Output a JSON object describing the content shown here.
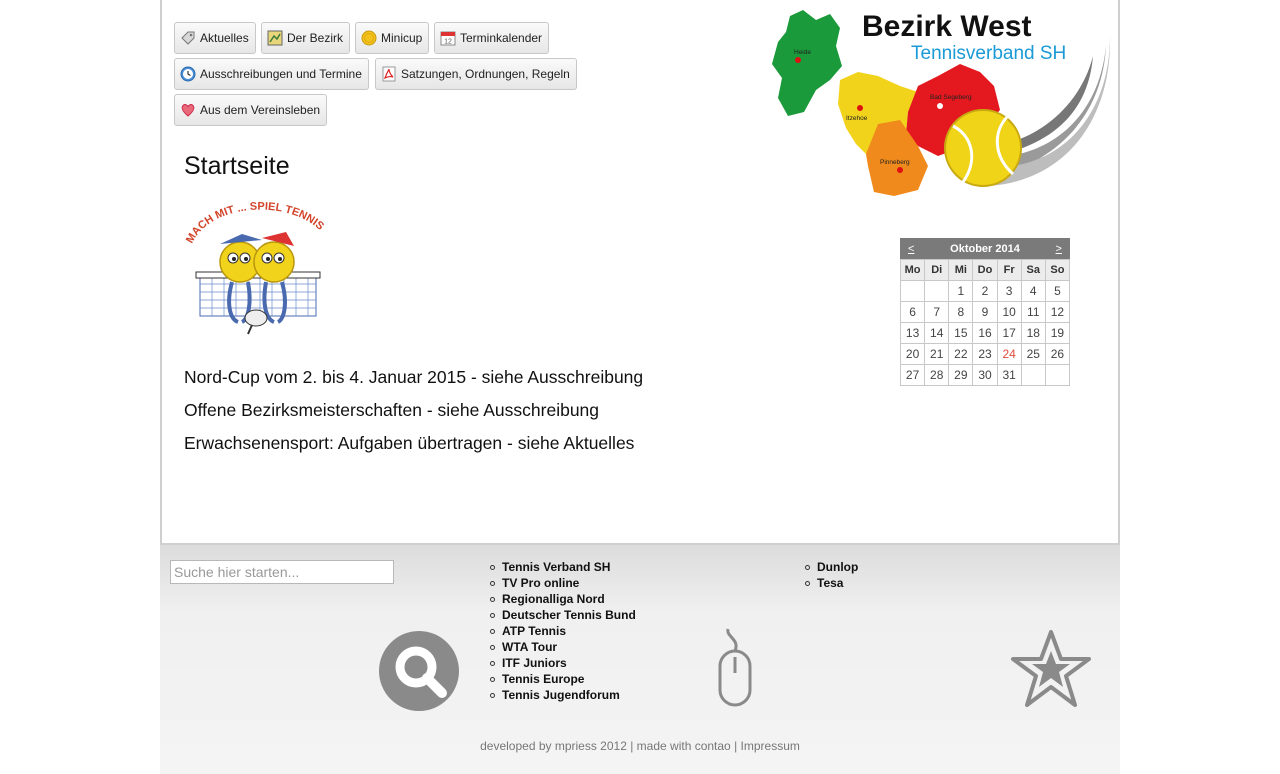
{
  "nav": {
    "items": [
      {
        "label": "Aktuelles",
        "icon": "tag-icon"
      },
      {
        "label": "Der Bezirk",
        "icon": "map-icon"
      },
      {
        "label": "Minicup",
        "icon": "coin-icon"
      },
      {
        "label": "Terminkalender",
        "icon": "calendar-icon"
      },
      {
        "label": "Ausschreibungen und Termine",
        "icon": "clock-icon"
      },
      {
        "label": "Satzungen, Ordnungen, Regeln",
        "icon": "pdf-icon"
      },
      {
        "label": "Aus dem Vereinsleben",
        "icon": "heart-icon"
      }
    ]
  },
  "logo": {
    "title": "Bezirk West",
    "subtitle": "Tennisverband SH",
    "cities": [
      "Heide",
      "Itzehoe",
      "Bad Segeberg",
      "Pinneberg"
    ]
  },
  "main": {
    "title": "Startseite",
    "mascot_text": "MACH MIT ... SPIEL TENNIS",
    "news": [
      "Nord-Cup vom 2. bis 4. Januar 2015 - siehe Ausschreibung",
      "Offene Bezirksmeisterschaften - siehe  Ausschreibung",
      "Erwachsenensport: Aufgaben übertragen - siehe Aktuelles"
    ]
  },
  "calendar": {
    "month_label": "Oktober 2014",
    "prev": "<",
    "next": ">",
    "weekdays": [
      "Mo",
      "Di",
      "Mi",
      "Do",
      "Fr",
      "Sa",
      "So"
    ],
    "weeks": [
      [
        "",
        "",
        "1",
        "2",
        "3",
        "4",
        "5"
      ],
      [
        "6",
        "7",
        "8",
        "9",
        "10",
        "11",
        "12"
      ],
      [
        "13",
        "14",
        "15",
        "16",
        "17",
        "18",
        "19"
      ],
      [
        "20",
        "21",
        "22",
        "23",
        "24",
        "25",
        "26"
      ],
      [
        "27",
        "28",
        "29",
        "30",
        "31",
        "",
        ""
      ]
    ],
    "today": "24",
    "today_color": "#e0503c"
  },
  "footer": {
    "search_placeholder": "Suche hier starten...",
    "links_col1": [
      "Tennis Verband SH",
      "TV Pro online",
      "Regionalliga Nord",
      "Deutscher Tennis Bund",
      "ATP Tennis",
      "WTA Tour",
      "ITF Juniors",
      "Tennis Europe",
      "Tennis Jugendforum"
    ],
    "links_col2": [
      "Dunlop",
      "Tesa"
    ],
    "credit_developed": "developed by mpriess 2012",
    "credit_sep": " | ",
    "credit_contao": "made with contao",
    "credit_impressum": "Impressum",
    "icons": [
      "search-icon",
      "mouse-icon",
      "star-icon"
    ]
  },
  "colors": {
    "accent_blue": "#1a9ad6",
    "map_green": "#1a9a3a",
    "map_yellow": "#f2d31b",
    "map_red": "#e3191f",
    "map_orange": "#f08a1c"
  }
}
